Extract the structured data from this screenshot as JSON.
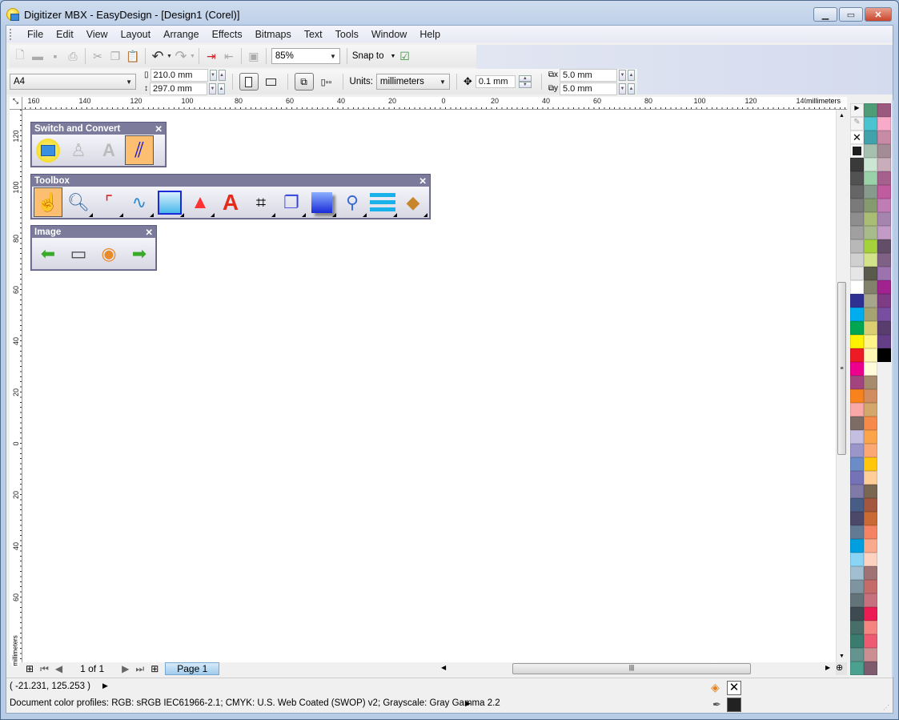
{
  "window": {
    "title": "Digitizer MBX - EasyDesign - [Design1 (Corel)]",
    "controls": [
      "minimize",
      "maximize",
      "close"
    ]
  },
  "menu": [
    "File",
    "Edit",
    "View",
    "Layout",
    "Arrange",
    "Effects",
    "Bitmaps",
    "Text",
    "Tools",
    "Window",
    "Help"
  ],
  "toolbar": {
    "zoom_value": "85%",
    "snap_label": "Snap to"
  },
  "property_bar": {
    "paper_size": "A4",
    "width": "210.0 mm",
    "height": "297.0 mm",
    "units_label": "Units:",
    "units_value": "millimeters",
    "nudge": "0.1 mm",
    "dup_x": "5.0 mm",
    "dup_y": "5.0 mm"
  },
  "rulers": {
    "h_labels": [
      "160",
      "140",
      "120",
      "100",
      "80",
      "60",
      "40",
      "20",
      "0",
      "20",
      "40",
      "60",
      "80",
      "100",
      "120",
      "140"
    ],
    "h_unit": "millimeters",
    "v_labels": [
      "120",
      "100",
      "80",
      "60",
      "40",
      "20",
      "0",
      "20",
      "40",
      "60"
    ],
    "v_unit": "millimeters"
  },
  "panels": {
    "switch": {
      "title": "Switch and Convert",
      "close": "✕"
    },
    "toolbox": {
      "title": "Toolbox",
      "close": "✕"
    },
    "image": {
      "title": "Image",
      "close": "✕"
    }
  },
  "page_nav": {
    "counter": "1 of 1",
    "tab": "Page 1"
  },
  "status": {
    "coords": "( -21.231, 125.253 )",
    "profiles": "Document color profiles: RGB: sRGB IEC61966-2.1; CMYK: U.S. Web Coated (SWOP) v2; Grayscale: Gray Gamma 2.2"
  },
  "palette": {
    "col1": [
      "#3a3a3a",
      "#525252",
      "#666666",
      "#7a7a7a",
      "#8e8e8e",
      "#a0a0a0",
      "#b8b8b8",
      "#d0d0d0",
      "#e6e6e6",
      "#ffffff",
      "#2e3192",
      "#00aeef",
      "#00a651",
      "#fff200",
      "#ed1c24",
      "#ec008c",
      "#a2457e",
      "#f7821e",
      "#f9a8a8",
      "#7d6b65",
      "#c4bfe0",
      "#9a96c9",
      "#6b8cc7",
      "#7672b8",
      "#7f7ba6",
      "#475d86",
      "#4b4869",
      "#627a93",
      "#009fdf",
      "#8ad5f5",
      "#a1bfd1",
      "#7e95a1",
      "#627479",
      "#3e4a52",
      "#486e6a",
      "#3a7c6e",
      "#659390",
      "#4aa18f"
    ],
    "col2": [
      "#4f9d77",
      "#4bc4cf",
      "#41a2ac",
      "#a6c0b0",
      "#cce6d4",
      "#99d2a9",
      "#879a8b",
      "#869a70",
      "#aabd75",
      "#a7bb8b",
      "#a5d13a",
      "#d3e38a",
      "#595a4c",
      "#82826c",
      "#a7a58a",
      "#a7a271",
      "#dbcf72",
      "#fff48a",
      "#fff8b4",
      "#fffbdb",
      "#a68b6c",
      "#d18c5f",
      "#d4a76a",
      "#f68a4a",
      "#fba44a",
      "#fba875",
      "#ffc60b",
      "#ffcd98",
      "#7a6751",
      "#a4573f",
      "#c96a35",
      "#f48364",
      "#f9a98c",
      "#fdd2c0",
      "#9f7373",
      "#c56c6a",
      "#c7717f",
      "#ec1b54",
      "#f58580",
      "#ed5b73",
      "#ca8e93",
      "#7f5b6e"
    ],
    "col3": [
      "#9b5980",
      "#f8abc9",
      "#c78ba5",
      "#a48c97",
      "#c9adbb",
      "#a5608e",
      "#c05b9f",
      "#c07cb4",
      "#a585af",
      "#c29bc7",
      "#624e68",
      "#7e6185",
      "#9c72af",
      "#a0238f",
      "#7e3c85",
      "#784fa0",
      "#5a3d6f",
      "#643f88",
      "#000000"
    ]
  }
}
